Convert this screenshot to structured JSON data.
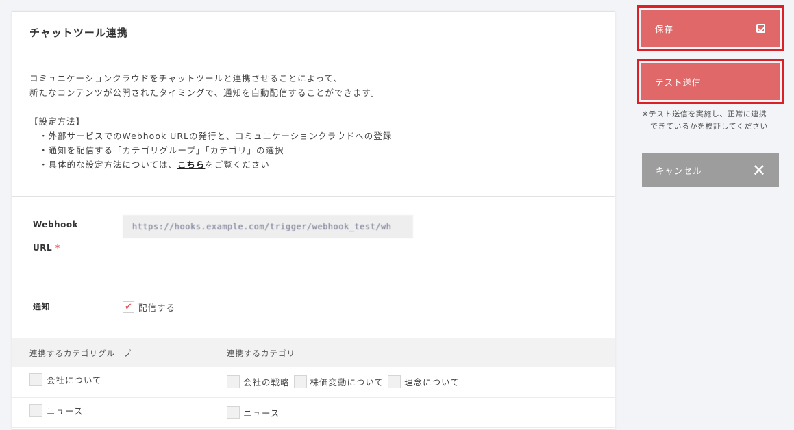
{
  "card": {
    "title": "チャットツール連携",
    "intro_line1": "コミュニケーションクラウドをチャットツールと連携させることによって、",
    "intro_line2": "新たなコンテンツが公開されたタイミングで、通知を自動配信することができます。",
    "method_heading": "【設定方法】",
    "method_items": [
      "・外部サービスでのWebhook URLの発行と、コミュニケーションクラウドへの登録",
      "・通知を配信する「カテゴリグループ」「カテゴリ」の選択"
    ],
    "method_last_prefix": "・具体的な設定方法については、",
    "method_last_link": "こちら",
    "method_last_suffix": "をご覧ください"
  },
  "form": {
    "webhook_label_1": "Webhook",
    "webhook_label_2": "URL",
    "required_mark": "*",
    "webhook_value": "https://hooks.example.com/trigger/webhook_test/wh",
    "notify_label": "通知",
    "notify_checkbox_label": "配信する",
    "notify_checked": true
  },
  "categories": {
    "group_header": "連携するカテゴリグループ",
    "category_header": "連携するカテゴリ",
    "rows": [
      {
        "group": "会社について",
        "group_checked": false,
        "items": [
          {
            "label": "会社の戦略",
            "checked": false
          },
          {
            "label": "株価変動について",
            "checked": false
          },
          {
            "label": "理念について",
            "checked": false
          }
        ]
      },
      {
        "group": "ニュース",
        "group_checked": false,
        "items": [
          {
            "label": "ニュース",
            "checked": false
          }
        ]
      }
    ]
  },
  "actions": {
    "save_label": "保存",
    "test_label": "テスト送信",
    "test_note_line1": "※テスト送信を実施し、正常に連携",
    "test_note_line2": "できているかを検証してください",
    "cancel_label": "キャンセル"
  },
  "colors": {
    "primary_button": "#e06868",
    "highlight_outline": "#dd1f26",
    "cancel_button": "#9d9d9d",
    "check_mark": "#e05a5a"
  },
  "icons": {
    "save": "check-square-icon",
    "cancel": "close-icon",
    "notify": "checkmark-icon"
  }
}
